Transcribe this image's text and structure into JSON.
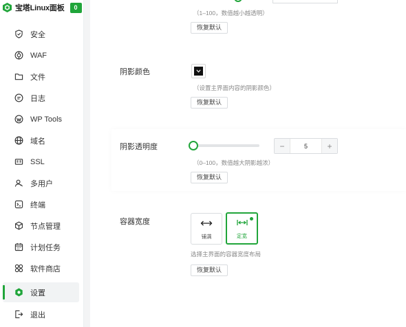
{
  "brand": {
    "title": "宝塔Linux面板",
    "badge": "0",
    "accent": "#20a53a"
  },
  "sidebar": {
    "items": [
      {
        "label": "安全",
        "icon": "shield-icon"
      },
      {
        "label": "WAF",
        "icon": "waf-icon"
      },
      {
        "label": "文件",
        "icon": "folder-icon"
      },
      {
        "label": "日志",
        "icon": "log-icon"
      },
      {
        "label": "WP Tools",
        "icon": "wordpress-icon"
      },
      {
        "label": "域名",
        "icon": "globe-icon"
      },
      {
        "label": "SSL",
        "icon": "ssl-icon"
      },
      {
        "label": "多用户",
        "icon": "users-icon"
      },
      {
        "label": "终端",
        "icon": "terminal-icon"
      },
      {
        "label": "节点管理",
        "icon": "cube-icon"
      },
      {
        "label": "计划任务",
        "icon": "calendar-icon"
      },
      {
        "label": "软件商店",
        "icon": "apps-icon"
      },
      {
        "label": "设置",
        "icon": "settings-icon",
        "active": true
      },
      {
        "label": "退出",
        "icon": "logout-icon"
      }
    ]
  },
  "settings": {
    "top_hint": "（1–100，数值越小越透明）",
    "top_reset": "恢复默认",
    "shadow_color": {
      "label": "阴影颜色",
      "value": "#111111",
      "hint": "（设置主界面内容的阴影颜色）",
      "reset": "恢复默认"
    },
    "shadow_opacity": {
      "label": "阴影透明度",
      "value": "5",
      "minus": "−",
      "plus": "+",
      "hint": "（0–100，数值越大阴影越浓）",
      "reset": "恢复默认"
    },
    "container_width": {
      "label": "容器宽度",
      "options": [
        {
          "label": "铺满",
          "icon": "expand-arrows-icon"
        },
        {
          "label": "定宽",
          "icon": "fixed-width-icon",
          "selected": true
        }
      ],
      "hint": "选择主界面的容器宽度布局",
      "reset": "恢复默认"
    }
  }
}
